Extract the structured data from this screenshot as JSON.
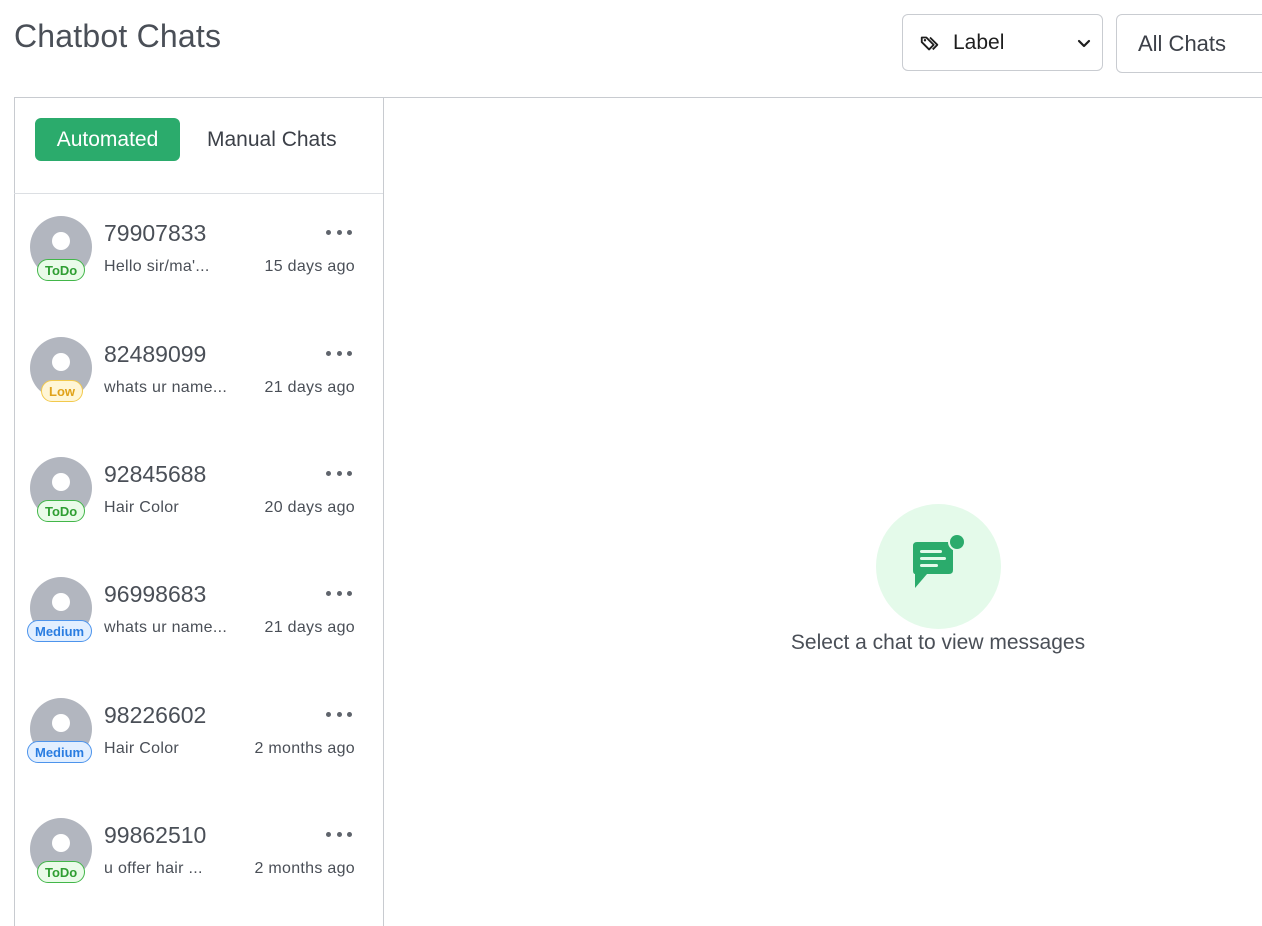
{
  "header": {
    "title": "Chatbot Chats",
    "label_filter": {
      "value": "Label",
      "icon": "tag-icon"
    },
    "chats_filter": {
      "value": "All Chats"
    }
  },
  "tabs": {
    "automated": "Automated",
    "manual": "Manual Chats",
    "active": "Automated",
    "active_color": "#2bab6c"
  },
  "chats": [
    {
      "name": "79907833",
      "preview": "Hello sir/ma'...",
      "time": "15 days ago",
      "priority": "ToDo"
    },
    {
      "name": "82489099",
      "preview": "whats ur name...",
      "time": "21 days ago",
      "priority": "Low"
    },
    {
      "name": "92845688",
      "preview": "Hair Color",
      "time": "20 days ago",
      "priority": "ToDo"
    },
    {
      "name": "96998683",
      "preview": "whats ur name...",
      "time": "21 days ago",
      "priority": "Medium"
    },
    {
      "name": "98226602",
      "preview": "Hair Color",
      "time": "2 months ago",
      "priority": "Medium"
    },
    {
      "name": "99862510",
      "preview": "u offer hair ...",
      "time": "2 months ago",
      "priority": "ToDo"
    }
  ],
  "empty_state": {
    "icon": "chat-notification-icon",
    "message": "Select a chat to view messages"
  }
}
